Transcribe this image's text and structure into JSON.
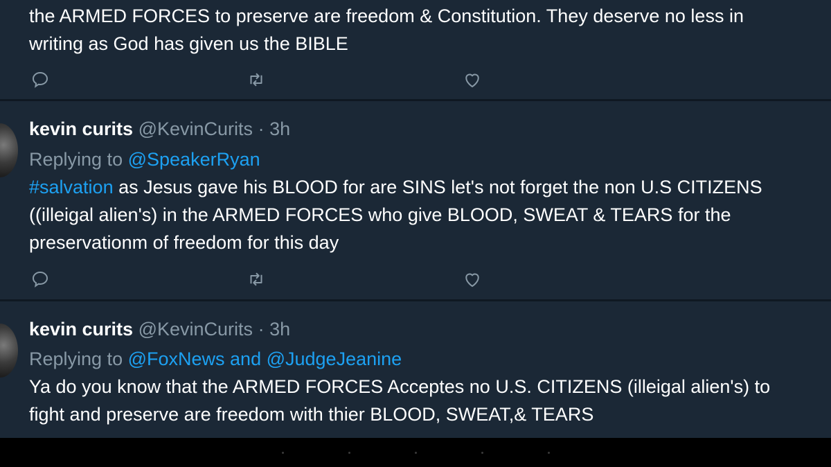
{
  "tweets": [
    {
      "lines": [
        "the ARMED FORCES to preserve are freedom & Constitution. They deserve no less in",
        "writing  as God has given us the BIBLE"
      ]
    },
    {
      "name": "kevin curits",
      "handle": "@KevinCurits",
      "sep": "·",
      "time": "3h",
      "replying_label": "Replying to",
      "replying_to": "@SpeakerRyan",
      "hashtag": "#salvation",
      "line1_rest": " as Jesus gave his BLOOD for are SINS let's not forget the non U.S CITIZENS",
      "line2": "((illeigal alien's) in the ARMED FORCES who give BLOOD, SWEAT & TEARS for the",
      "line3": "preservationm of freedom for this day"
    },
    {
      "name": "kevin curits",
      "handle": "@KevinCurits",
      "sep": "·",
      "time": "3h",
      "replying_label": "Replying to",
      "replying_to": "@FoxNews and @JudgeJeanine",
      "line1": "Ya do you know that the ARMED FORCES Acceptes no U.S. CITIZENS (illeigal alien's) to",
      "line2": "fight and preserve are freedom with thier BLOOD, SWEAT,& TEARS"
    }
  ],
  "icons": {
    "reply": "reply-icon",
    "retweet": "retweet-icon",
    "like": "heart-icon"
  },
  "colors": {
    "background": "#1b2836",
    "mention": "#1da1f2",
    "muted": "#8899a6"
  }
}
